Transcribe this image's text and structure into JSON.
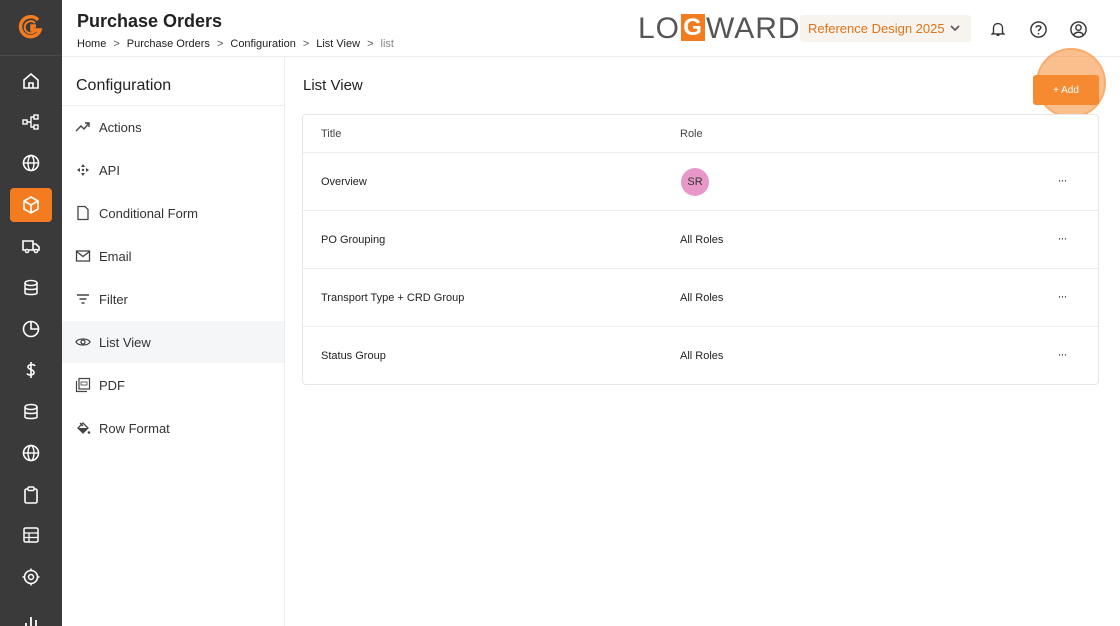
{
  "header": {
    "title": "Purchase Orders",
    "breadcrumb": [
      "Home",
      "Purchase Orders",
      "Configuration",
      "List View",
      "list"
    ],
    "brand_left": "LO",
    "brand_g": "G",
    "brand_right": "WARD",
    "workspace": "Reference Design 2025"
  },
  "rail": {
    "accent": "#f47c20",
    "items": [
      "home-icon",
      "network-icon",
      "globe-icon",
      "box-icon",
      "truck-icon",
      "database-icon",
      "pie-chart-icon",
      "dollar-icon",
      "database-icon",
      "globe-icon",
      "clipboard-icon",
      "grid-icon",
      "target-icon",
      "bar-chart-icon"
    ]
  },
  "config": {
    "title": "Configuration",
    "items": [
      "Actions",
      "API",
      "Conditional Form",
      "Email",
      "Filter",
      "List View",
      "PDF",
      "Row Format"
    ],
    "active": "List View"
  },
  "main": {
    "title": "List View",
    "add_label": "+ Add",
    "columns": [
      "Title",
      "Role"
    ],
    "rows": [
      {
        "title": "Overview",
        "role": "SR"
      },
      {
        "title": "PO Grouping",
        "role": "All Roles"
      },
      {
        "title": "Transport Type + CRD Group",
        "role": "All Roles"
      },
      {
        "title": "Status Group",
        "role": "All Roles"
      }
    ],
    "more": "···"
  }
}
